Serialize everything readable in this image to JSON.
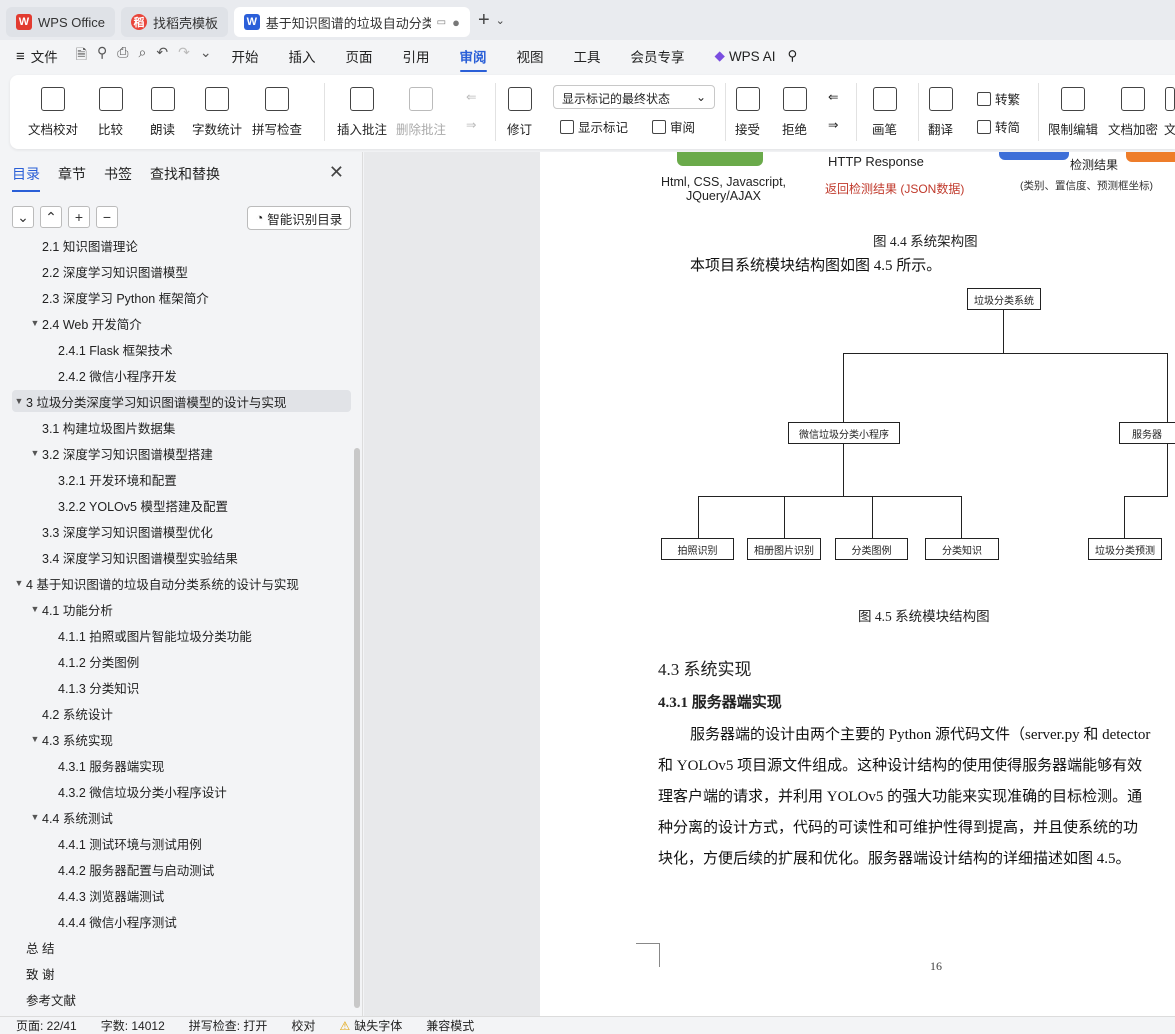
{
  "tabs": [
    {
      "label": "WPS Office",
      "icon": "wps-logo-icon"
    },
    {
      "label": "找稻壳模板",
      "icon": "docer-logo-icon"
    },
    {
      "label": "基于知识图谱的垃圾自动分类系统的设计与实现",
      "icon": "writer-logo-icon"
    }
  ],
  "menubar": {
    "file": "文件",
    "items": [
      "开始",
      "插入",
      "页面",
      "引用",
      "审阅",
      "视图",
      "工具",
      "会员专享"
    ],
    "active": "审阅",
    "wps_ai": "WPS AI"
  },
  "ribbon": {
    "doc_check": "文档校对",
    "compare": "比较",
    "read_aloud": "朗读",
    "word_count": "字数统计",
    "spell_check": "拼写检查",
    "insert_comment": "插入批注",
    "delete_comment": "删除批注",
    "track": "修订",
    "display_mode": "显示标记的最终状态",
    "show_markup": "显示标记",
    "review": "审阅",
    "accept": "接受",
    "reject": "拒绝",
    "pen": "画笔",
    "translate": "翻译",
    "to_traditional": "转繁",
    "to_simplified": "转简",
    "restrict_edit": "限制编辑",
    "encrypt": "文档加密",
    "more": "文"
  },
  "sidebar": {
    "tabs": [
      "目录",
      "章节",
      "书签",
      "查找和替换"
    ],
    "active_tab": "目录",
    "smart_toc": "智能识别目录",
    "toc": [
      {
        "text": "2.1  知识图谱理论",
        "level": 2,
        "arrow": ""
      },
      {
        "text": "2.2  深度学习知识图谱模型",
        "level": 2,
        "arrow": ""
      },
      {
        "text": "2.3  深度学习 Python 框架简介",
        "level": 2,
        "arrow": ""
      },
      {
        "text": "2.4 Web 开发简介",
        "level": 2,
        "arrow": "▼"
      },
      {
        "text": "2.4.1 Flask 框架技术",
        "level": 3,
        "arrow": ""
      },
      {
        "text": "2.4.2  微信小程序开发",
        "level": 3,
        "arrow": ""
      },
      {
        "text": "3  垃圾分类深度学习知识图谱模型的设计与实现",
        "level": 1,
        "arrow": "▼",
        "selected": true
      },
      {
        "text": "3.1  构建垃圾图片数据集",
        "level": 2,
        "arrow": ""
      },
      {
        "text": "3.2  深度学习知识图谱模型搭建",
        "level": 2,
        "arrow": "▼"
      },
      {
        "text": "3.2.1  开发环境和配置",
        "level": 3,
        "arrow": ""
      },
      {
        "text": "3.2.2 YOLOv5 模型搭建及配置",
        "level": 3,
        "arrow": ""
      },
      {
        "text": "3.3  深度学习知识图谱模型优化",
        "level": 2,
        "arrow": ""
      },
      {
        "text": "3.4  深度学习知识图谱模型实验结果",
        "level": 2,
        "arrow": ""
      },
      {
        "text": "4  基于知识图谱的垃圾自动分类系统的设计与实现",
        "level": 1,
        "arrow": "▼"
      },
      {
        "text": "4.1  功能分析",
        "level": 2,
        "arrow": "▼"
      },
      {
        "text": "4.1.1  拍照或图片智能垃圾分类功能",
        "level": 3,
        "arrow": ""
      },
      {
        "text": "4.1.2  分类图例",
        "level": 3,
        "arrow": ""
      },
      {
        "text": "4.1.3  分类知识",
        "level": 3,
        "arrow": ""
      },
      {
        "text": "4.2  系统设计",
        "level": 2,
        "arrow": ""
      },
      {
        "text": "4.3  系统实现",
        "level": 2,
        "arrow": "▼"
      },
      {
        "text": "4.3.1  服务器端实现",
        "level": 3,
        "arrow": ""
      },
      {
        "text": "4.3.2  微信垃圾分类小程序设计",
        "level": 3,
        "arrow": ""
      },
      {
        "text": "4.4  系统测试",
        "level": 2,
        "arrow": "▼"
      },
      {
        "text": "4.4.1  测试环境与测试用例",
        "level": 3,
        "arrow": ""
      },
      {
        "text": "4.4.2  服务器配置与启动测试",
        "level": 3,
        "arrow": ""
      },
      {
        "text": "4.4.3  浏览器端测试",
        "level": 3,
        "arrow": ""
      },
      {
        "text": "4.4.4  微信小程序测试",
        "level": 3,
        "arrow": ""
      },
      {
        "text": "总    结",
        "level": 1,
        "arrow": ""
      },
      {
        "text": "致    谢",
        "level": 1,
        "arrow": ""
      },
      {
        "text": "参考文献",
        "level": 1,
        "arrow": ""
      }
    ]
  },
  "doc": {
    "fig44": {
      "left_label": "Html, CSS, Javascript,",
      "left_label2": "JQuery/AJAX",
      "http_response": "HTTP Response",
      "return_result": "返回检测结果 (JSON数据)",
      "detect_result": "检测结果",
      "detect_detail": "(类别、置信度、预测框坐标)",
      "caption": "图 4.4    系统架构图"
    },
    "intro_line": "本项目系统模块结构图如图 4.5 所示。",
    "fig45": {
      "root": "垃圾分类系统",
      "mid_left": "微信垃圾分类小程序",
      "mid_right": "服务器",
      "leaf1": "拍照识别",
      "leaf2": "相册图片识别",
      "leaf3": "分类图例",
      "leaf4": "分类知识",
      "leaf5": "垃圾分类预测",
      "caption": "图 4.5    系统模块结构图"
    },
    "heading_43": "4.3  系统实现",
    "heading_431": "4.3.1  服务器端实现",
    "para": [
      "服务器端的设计由两个主要的 Python 源代码文件（server.py 和 detector",
      "和 YOLOv5 项目源文件组成。这种设计结构的使用使得服务器端能够有效",
      "理客户端的请求，并利用 YOLOv5 的强大功能来实现准确的目标检测。通",
      "种分离的设计方式，代码的可读性和可维护性得到提高，并且使系统的功",
      "块化，方便后续的扩展和优化。服务器端设计结构的详细描述如图 4.5。"
    ],
    "page_number": "16"
  },
  "status": {
    "page": "页面: 22/41",
    "words": "字数: 14012",
    "spell": "拼写检查: 打开",
    "proof": "校对",
    "missing_font": "缺失字体",
    "compat": "兼容模式"
  }
}
